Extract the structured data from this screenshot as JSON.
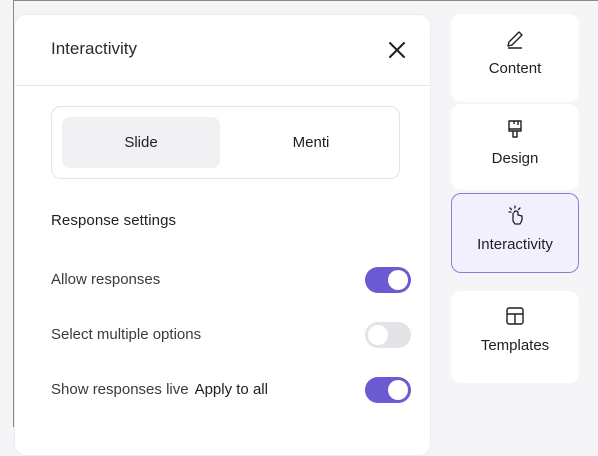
{
  "panel": {
    "title": "Interactivity",
    "segments": [
      "Slide",
      "Menti"
    ],
    "section_title": "Response settings",
    "settings": [
      {
        "label": "Allow responses",
        "on": true
      },
      {
        "label": "Select multiple options",
        "on": false
      },
      {
        "label": "Show responses live",
        "link": "Apply to all",
        "on": true
      }
    ]
  },
  "sidebar": {
    "tabs": [
      {
        "label": "Content",
        "icon": "pencil-icon"
      },
      {
        "label": "Design",
        "icon": "paintbrush-icon"
      },
      {
        "label": "Interactivity",
        "icon": "tap-hand-icon",
        "active": true
      },
      {
        "label": "Templates",
        "icon": "grid-layout-icon"
      }
    ]
  },
  "colors": {
    "accent": "#6b5bd2",
    "toggle_off": "#e4e4e8",
    "active_tab_bg": "#f2f0fc",
    "active_tab_border": "#8c7ed8"
  }
}
